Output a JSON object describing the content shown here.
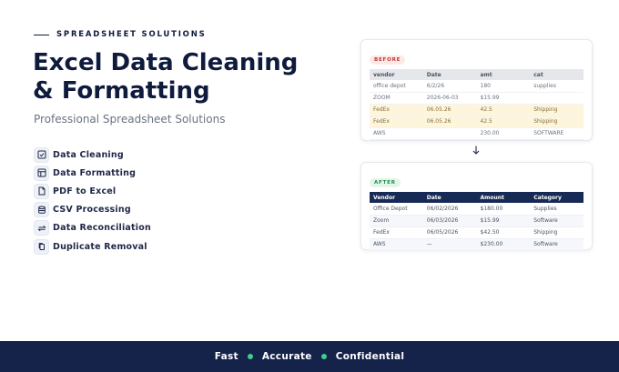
{
  "header": {
    "eyebrow": "SPREADSHEET SOLUTIONS",
    "title_line1": "Excel Data Cleaning",
    "title_line2": "& Formatting",
    "subtitle": "Professional Spreadsheet Solutions"
  },
  "features": [
    {
      "label": "Data Cleaning",
      "icon": "checkbox-icon"
    },
    {
      "label": "Data Formatting",
      "icon": "table-layout-icon"
    },
    {
      "label": "PDF to Excel",
      "icon": "document-icon"
    },
    {
      "label": "CSV Processing",
      "icon": "database-icon"
    },
    {
      "label": "Data Reconciliation",
      "icon": "sync-arrows-icon"
    },
    {
      "label": "Duplicate Removal",
      "icon": "copy-icon"
    }
  ],
  "before": {
    "badge": "BEFORE",
    "columns": [
      "vendor",
      "Date",
      "amt",
      "cat"
    ],
    "rows": [
      [
        "office depot",
        "6/2/26",
        "180",
        "supplies"
      ],
      [
        "ZOOM",
        "2026-06-03",
        "$15.99",
        ""
      ],
      [
        "FedEx",
        "06.05.26",
        "42.5",
        "Shipping"
      ],
      [
        "FedEx",
        "06.05.26",
        "42.5",
        "Shipping"
      ],
      [
        "AWS",
        "",
        "230.00",
        "SOFTWARE"
      ]
    ],
    "highlight_color": "#fdf6dd"
  },
  "after": {
    "badge": "AFTER",
    "columns": [
      "Vendor",
      "Date",
      "Amount",
      "Category"
    ],
    "rows": [
      [
        "Office Depot",
        "06/02/2026",
        "$180.00",
        "Supplies"
      ],
      [
        "Zoom",
        "06/03/2026",
        "$15.99",
        "Software"
      ],
      [
        "FedEx",
        "06/05/2026",
        "$42.50",
        "Shipping"
      ],
      [
        "AWS",
        "—",
        "$230.00",
        "Software"
      ]
    ],
    "header_color": "#172a56"
  },
  "footer": {
    "items": [
      "Fast",
      "Accurate",
      "Confidential"
    ],
    "background": "#15224a",
    "dot_color": "#3ecf8e"
  }
}
